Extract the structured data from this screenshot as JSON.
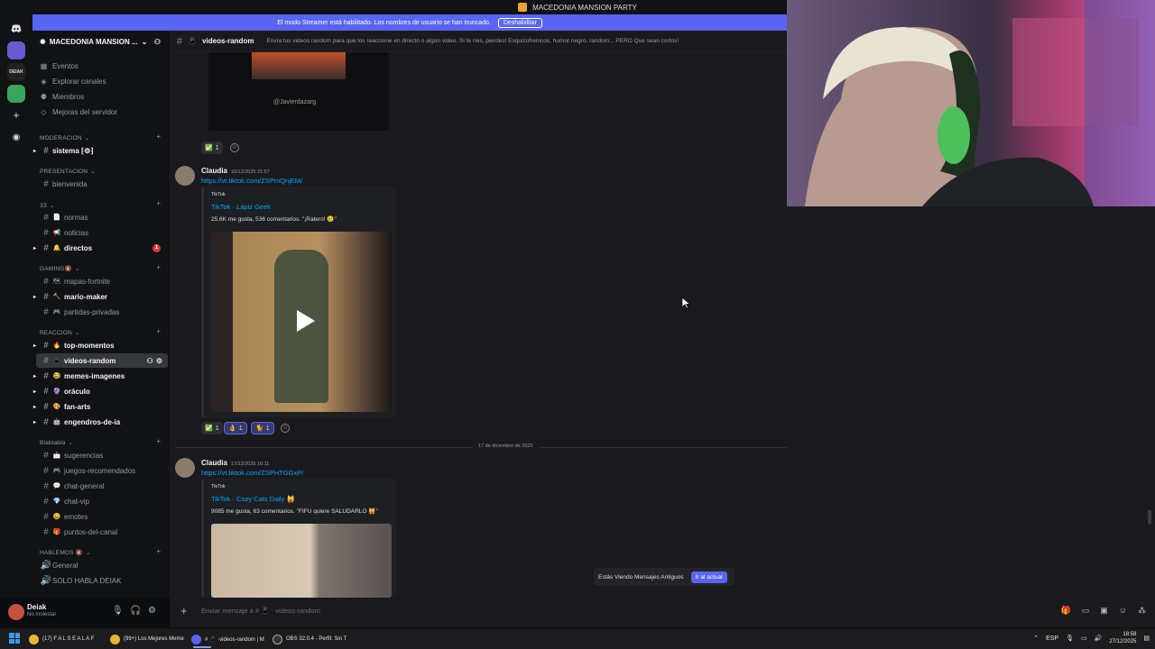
{
  "window": {
    "title": "MACEDONIA MANSION PARTY"
  },
  "streamer_banner": {
    "text": "El modo Streamer está habilitado. Los nombres de usuario se han truncado.",
    "button": "Deshabilitar"
  },
  "rail": {
    "server2_label": "DEIAK"
  },
  "server": {
    "name": "MACEDONIA MANSION ...",
    "nav": [
      {
        "label": "Eventos",
        "icon": "calendar-icon"
      },
      {
        "label": "Explorar canales",
        "icon": "compass-icon"
      },
      {
        "label": "Miembros",
        "icon": "members-icon"
      },
      {
        "label": "Mejoras del servidor",
        "icon": "boost-icon"
      }
    ]
  },
  "categories": {
    "moderacion": "MODERACION",
    "presentacion": "PRESENTACION",
    "misc": "ɜɜ",
    "gaming": "GAMING🔇",
    "reaccion": "REACCION",
    "blablabla": "Blablabla",
    "hablemos": "HABLEMOS 🔇"
  },
  "channels": {
    "sistema": "sistema ⁅⚙⁆",
    "bienvenida": "bienvenida",
    "normas": "normas",
    "noticias": "noticias",
    "directos": "directos",
    "directos_badge": "1",
    "mapas_fortnite": "mapas-fortnite",
    "mario_maker": "mario-maker",
    "partidas_privadas": "partidas-privadas",
    "top_momentos": "top-momentos",
    "videos_random": "videos-random",
    "memes_imagenes": "memes-imagenes",
    "oraculo": "oráculo",
    "fan_arts": "fan-arts",
    "engendros": "engendros-de-ia",
    "sugerencias": "sugerencias",
    "juegos": "juegos-recomendados",
    "chat_general": "chat-general",
    "chat_vip": "chat-vip",
    "emotes": "emotes",
    "puntos": "puntos-del-canal",
    "general": "General",
    "solo_habla": "SOLO HABLA DEIAK"
  },
  "user": {
    "name": "Deiak",
    "status": "No molestar"
  },
  "channel_header": {
    "name": "videos-random",
    "topic": "Envía tus videos random para que los reaccione en directo o algún video. Si te ríes, pierdes! Esquizofrenicos, humor negro, random... PERO Que sean cortos!"
  },
  "messages": [
    {
      "author": "Claudia",
      "time": "16/12/2025 21:57",
      "link": "https://vt.tiktok.com/ZSPmQnjEM/",
      "embed": {
        "provider": "TikTok",
        "title": "TikTok · Lápiz Geek",
        "desc": "25.6K me gusta, 536 comentarios. \"¡Ratero! 😢\""
      },
      "reactions": [
        {
          "emoji": "✅",
          "count": "1"
        },
        {
          "emoji": "👌",
          "count": "1"
        },
        {
          "emoji": "🐈",
          "count": "1"
        }
      ]
    },
    {
      "author": "Claudia",
      "time": "17/12/2025 16:11",
      "link": "https://vt.tiktok.com/ZSPHTGGxP/",
      "embed": {
        "provider": "TikTok",
        "title": "TikTok · Cozy Cats Daily 🙀",
        "desc": "9085 me gusta, 63 comentarios. \"FIFU quiere SALUDARLO 🙀\""
      }
    }
  ],
  "prev_message": {
    "watermark": "@Javierdazarg",
    "reaction_count": "1"
  },
  "date_divider": "17 de diciembre de 2025",
  "jump": {
    "text": "Estás Viendo Mensajes Antiguos",
    "button": "Ir al actual"
  },
  "composer": {
    "placeholder": "Enviar mensaje a # 📱 · videos-random"
  },
  "taskbar": {
    "items": [
      "(17) F A L S E  A L A F",
      "(99+) Los Mejores Meme",
      "# 📱 ·videos-random | M",
      "OBS 32.0.4 - Perfil: Sin T"
    ],
    "lang": "ESP",
    "time": "18:58",
    "date": "27/12/2025"
  },
  "colors": {
    "accent": "#5865f2",
    "link": "#00a8fc",
    "bg": "#1a1a1e",
    "sidebar": "#111214"
  }
}
